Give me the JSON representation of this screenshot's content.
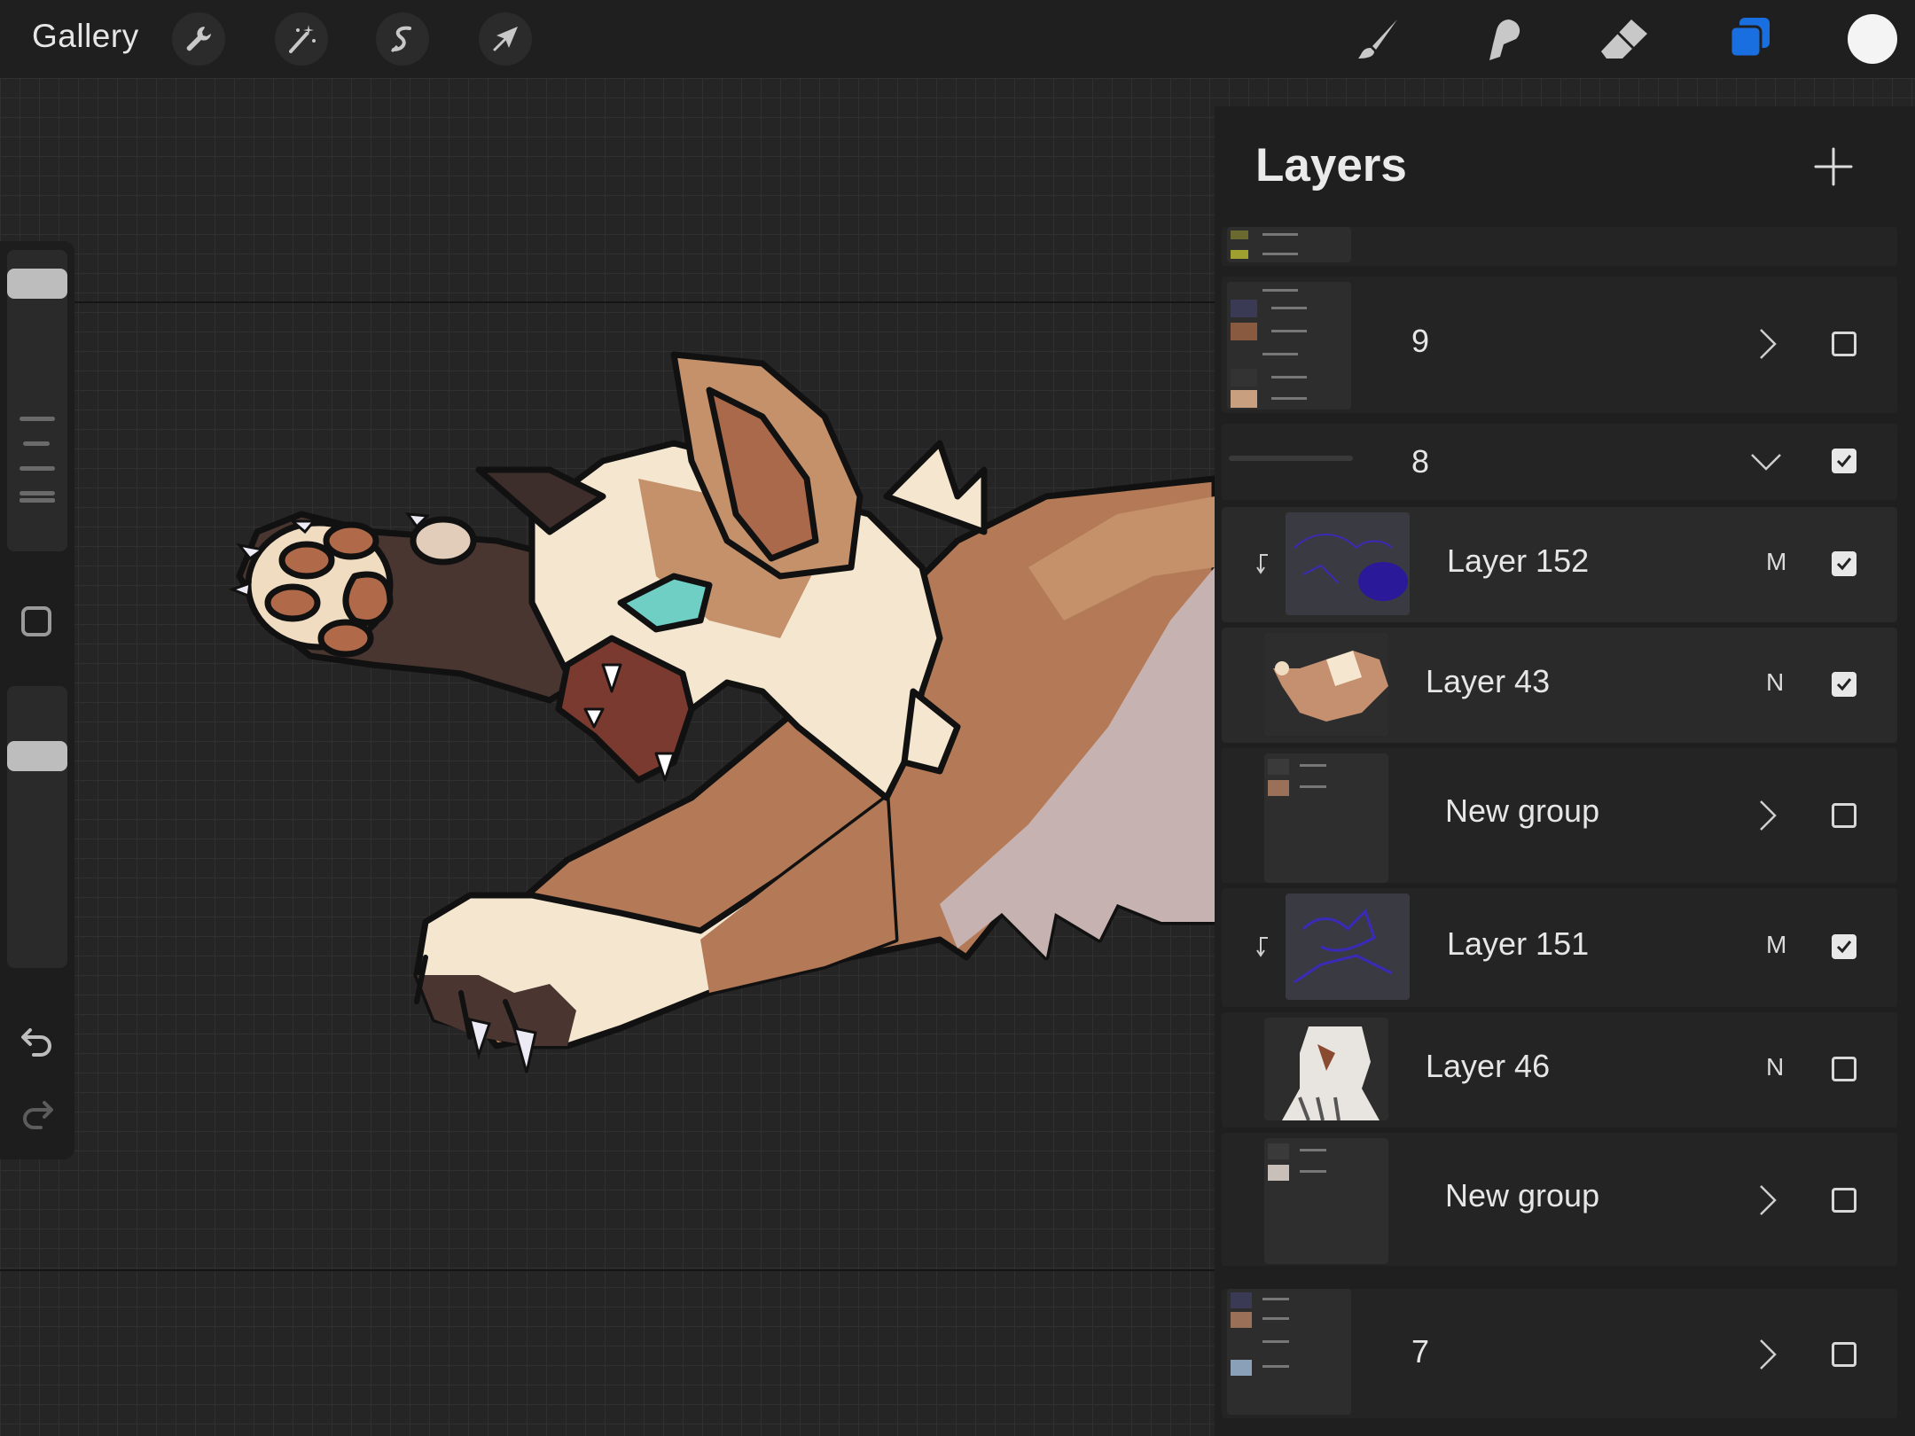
{
  "app": {
    "gallery_label": "Gallery"
  },
  "toolbar": {
    "left_tools": [
      "wrench-icon",
      "magic-wand-icon",
      "selection-s-icon",
      "transform-arrow-icon"
    ],
    "right_tools": [
      "brush-icon",
      "smudge-icon",
      "eraser-icon",
      "layers-icon"
    ],
    "active_tool": "layers-icon",
    "accent_color": "#1a6fe0",
    "current_color": "#f4f4f4"
  },
  "sidebar": {
    "brush_size_level": 0.93,
    "opacity_level": 0.78,
    "undo_icon": "undo-icon",
    "redo_icon": "redo-icon"
  },
  "layers_panel": {
    "title": "Layers",
    "add_icon": "plus-icon",
    "rows": [
      {
        "name": "9",
        "type": "group",
        "collapsed": true,
        "visible": false
      },
      {
        "name": "8",
        "type": "group",
        "collapsed": false,
        "visible": true
      },
      {
        "name": "Layer 152",
        "type": "layer",
        "blend": "M",
        "visible": true,
        "clipped": true
      },
      {
        "name": "Layer 43",
        "type": "layer",
        "blend": "N",
        "visible": true,
        "clipped": false
      },
      {
        "name": "New group",
        "type": "group",
        "collapsed": true,
        "visible": false
      },
      {
        "name": "Layer 151",
        "type": "layer",
        "blend": "M",
        "visible": true,
        "clipped": true
      },
      {
        "name": "Layer 46",
        "type": "layer",
        "blend": "N",
        "visible": false,
        "clipped": false
      },
      {
        "name": "New group",
        "type": "group",
        "collapsed": true,
        "visible": false
      },
      {
        "name": "7",
        "type": "group",
        "collapsed": true,
        "visible": false
      }
    ]
  }
}
